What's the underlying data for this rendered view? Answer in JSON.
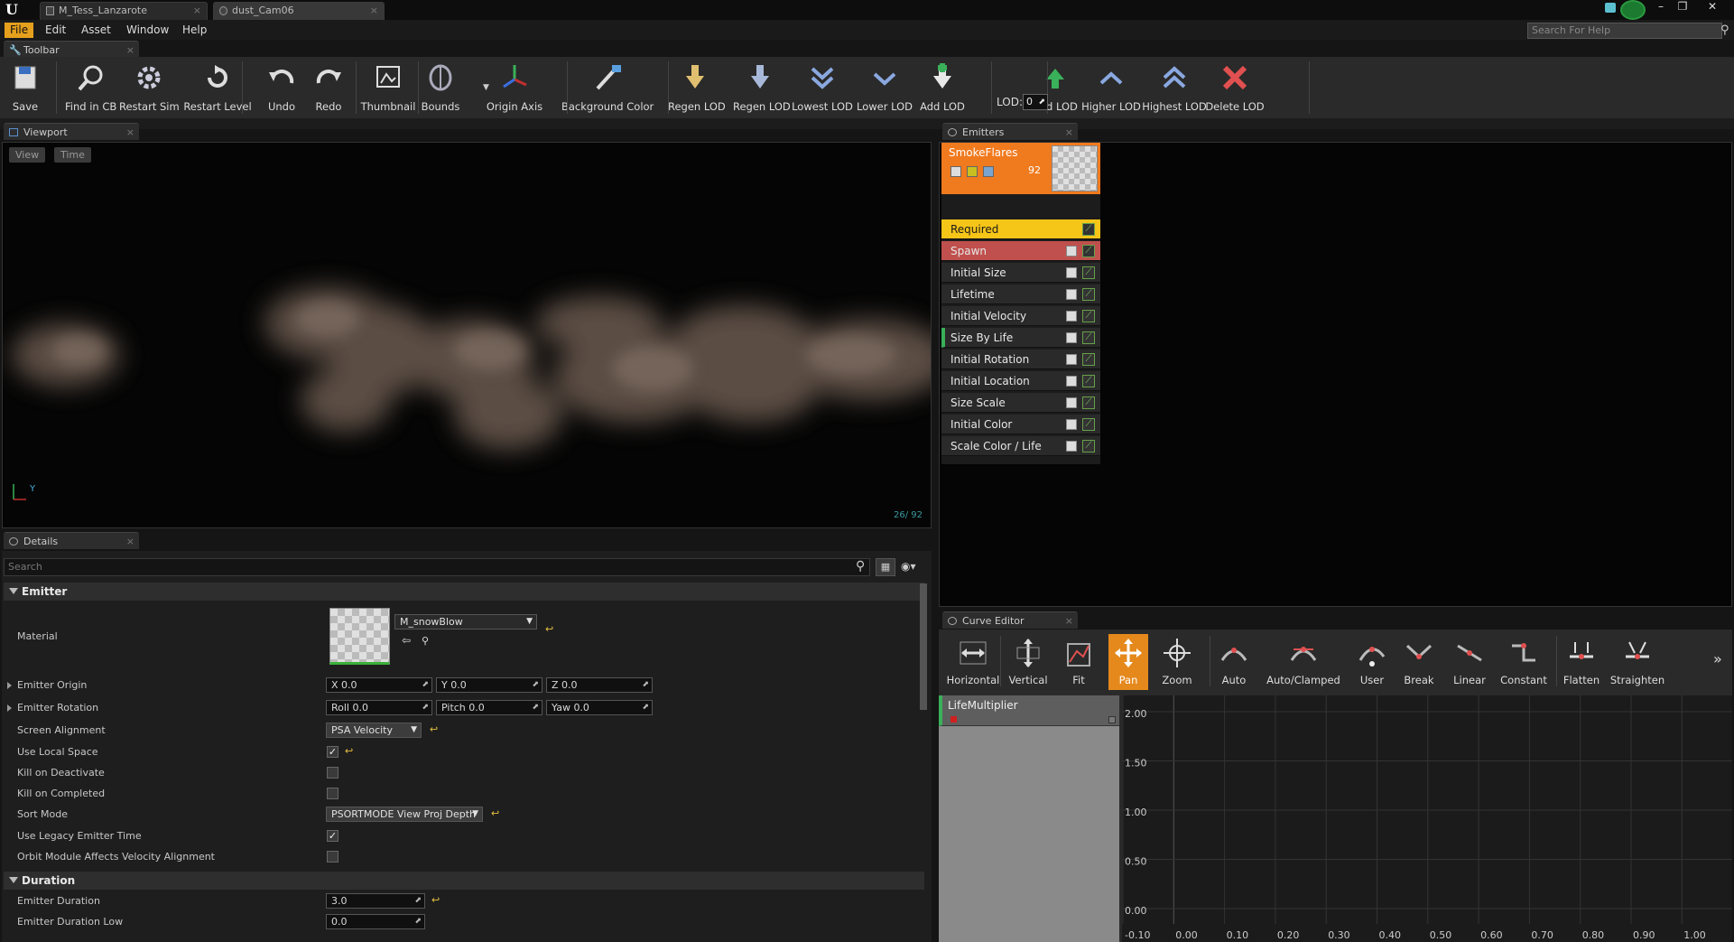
{
  "tabs": [
    {
      "label": "M_Tess_Lanzarote"
    },
    {
      "label": "dust_Cam06"
    }
  ],
  "menu": [
    "File",
    "Edit",
    "Asset",
    "Window",
    "Help"
  ],
  "help_search_placeholder": "Search For Help",
  "toolbar": {
    "title": "Toolbar",
    "buttons": [
      "Save",
      "Find in CB",
      "Restart Sim",
      "Restart Level",
      "Undo",
      "Redo",
      "Thumbnail",
      "Bounds",
      "Origin Axis",
      "Background Color",
      "Regen LOD",
      "Regen LOD",
      "Lowest LOD",
      "Lower LOD",
      "Add LOD",
      "Add LOD",
      "Higher LOD",
      "Highest LOD",
      "Delete LOD"
    ],
    "lod_label": "LOD:",
    "lod_value": "0"
  },
  "viewport": {
    "title": "Viewport",
    "view_btn": "View",
    "time_btn": "Time",
    "counter": "26/ 92"
  },
  "emitters": {
    "title": "Emitters",
    "emitter_name": "SmokeFlares",
    "particle_count": "92",
    "modules": [
      "Required",
      "Spawn",
      "Initial Size",
      "Lifetime",
      "Initial Velocity",
      "Size By Life",
      "Initial Rotation",
      "Initial Location",
      "Size Scale",
      "Initial Color",
      "Scale Color / Life"
    ]
  },
  "details": {
    "title": "Details",
    "search_placeholder": "Search",
    "cat_emitter": "Emitter",
    "material_label": "Material",
    "material_value": "M_snowBlow",
    "origin_label": "Emitter Origin",
    "origin_x": "X  0.0",
    "origin_y": "Y  0.0",
    "origin_z": "Z  0.0",
    "rotation_label": "Emitter Rotation",
    "rot_roll": "Roll  0.0",
    "rot_pitch": "Pitch  0.0",
    "rot_yaw": "Yaw  0.0",
    "screen_align_label": "Screen Alignment",
    "screen_align_value": "PSA Velocity",
    "use_local_label": "Use Local Space",
    "kill_deactivate_label": "Kill on Deactivate",
    "kill_completed_label": "Kill on Completed",
    "sort_mode_label": "Sort Mode",
    "sort_mode_value": "PSORTMODE View Proj Depth",
    "legacy_label": "Use Legacy Emitter Time",
    "orbit_label": "Orbit Module Affects Velocity Alignment",
    "cat_duration": "Duration",
    "duration_label": "Emitter Duration",
    "duration_value": "3.0",
    "duration_low_label": "Emitter Duration Low",
    "duration_low_value": "0.0"
  },
  "curve_editor": {
    "title": "Curve Editor",
    "buttons": [
      "Horizontal",
      "Vertical",
      "Fit",
      "Pan",
      "Zoom",
      "Auto",
      "Auto/Clamped",
      "User",
      "Break",
      "Linear",
      "Constant",
      "Flatten",
      "Straighten"
    ],
    "curve_name": "LifeMultiplier",
    "y_ticks": [
      "2.00",
      "1.50",
      "1.00",
      "0.50",
      "0.00"
    ],
    "x_ticks": [
      "-0.10",
      "0.00",
      "0.10",
      "0.20",
      "0.30",
      "0.40",
      "0.50",
      "0.60",
      "0.70",
      "0.80",
      "0.90",
      "1.00"
    ]
  },
  "colors": {
    "accent": "#e5a01d",
    "emitter_header": "#f07a1e",
    "required": "#f5c518",
    "spawn": "#c0504d",
    "pan_active": "#e5891d"
  }
}
